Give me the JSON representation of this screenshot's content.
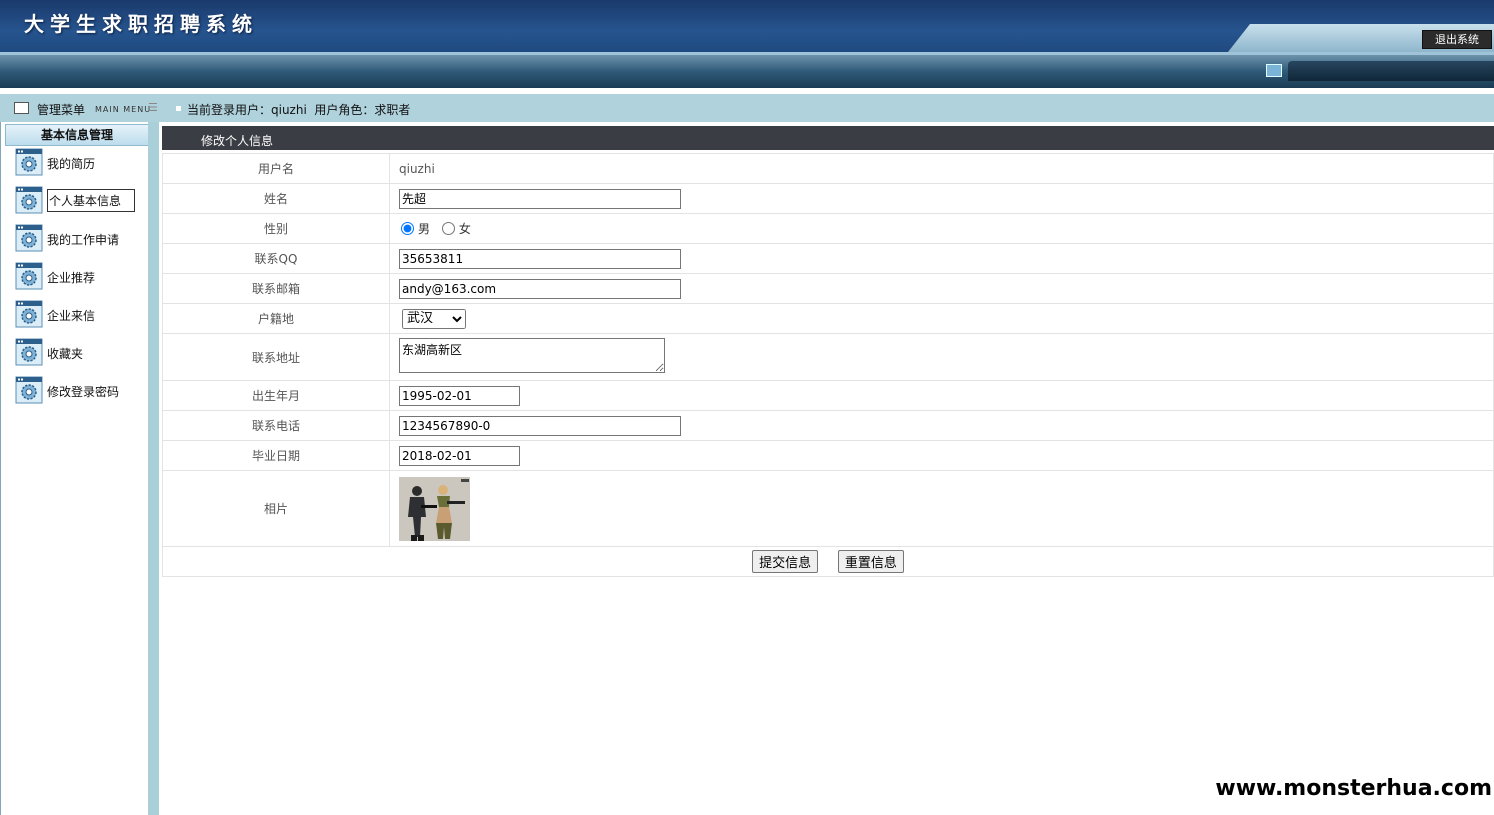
{
  "header": {
    "title": "大学生求职招聘系统",
    "logout_label": "退出系统"
  },
  "menu": {
    "title": "管理菜单",
    "title_en": "MAIN MENU",
    "group": "基本信息管理",
    "items": [
      {
        "label": "我的简历",
        "icon": "gear-icon"
      },
      {
        "label": "个人基本信息",
        "icon": "gear-icon"
      },
      {
        "label": "我的工作申请",
        "icon": "gear-icon"
      },
      {
        "label": "企业推荐",
        "icon": "gear-icon"
      },
      {
        "label": "企业来信",
        "icon": "gear-icon"
      },
      {
        "label": "收藏夹",
        "icon": "gear-icon"
      },
      {
        "label": "修改登录密码",
        "icon": "gear-icon"
      }
    ]
  },
  "status": {
    "text": "当前登录用户：qiuzhi  用户角色：求职者"
  },
  "form": {
    "title": "修改个人信息",
    "labels": {
      "username": "用户名",
      "name": "姓名",
      "gender": "性别",
      "qq": "联系QQ",
      "email": "联系邮箱",
      "hometown": "户籍地",
      "address": "联系地址",
      "birth": "出生年月",
      "phone": "联系电话",
      "graduation": "毕业日期",
      "photo": "相片"
    },
    "values": {
      "username": "qiuzhi",
      "name": "先超",
      "gender_male": "男",
      "gender_female": "女",
      "qq": "35653811",
      "email": "andy@163.com",
      "hometown": "武汉",
      "address": "东湖高新区",
      "birth": "1995-02-01",
      "phone": "1234567890-0",
      "graduation": "2018-02-01"
    },
    "submit_label": "提交信息",
    "reset_label": "重置信息"
  },
  "watermark": "www.monsterhua.com",
  "colors": {
    "header": "#1f4a80",
    "menu_bar": "#b0d2dc",
    "title_bar": "#3a3e44"
  }
}
